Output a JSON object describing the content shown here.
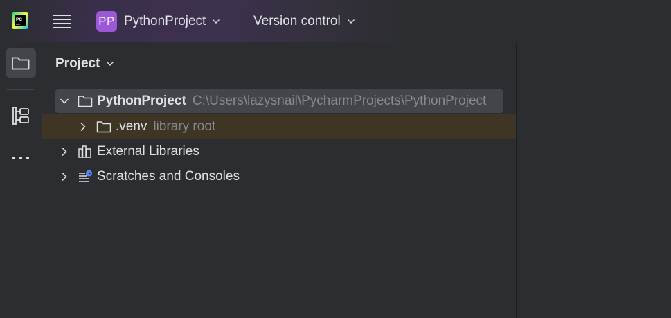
{
  "titlebar": {
    "app_logo": "pycharm-logo",
    "menu_icon": "hamburger-icon",
    "project_badge": "PP",
    "project_name": "PythonProject",
    "vcs_label": "Version control",
    "badge_color": "#9b59d8"
  },
  "toolstrip": {
    "items": [
      {
        "icon": "folder-icon",
        "active": true
      },
      {
        "icon": "structure-icon",
        "active": false
      },
      {
        "icon": "more-icon",
        "active": false
      }
    ]
  },
  "panel": {
    "title": "Project",
    "tree": [
      {
        "label": "PythonProject",
        "hint": "C:\\Users\\lazysnail\\PycharmProjects\\PythonProject",
        "expanded": true,
        "icon": "folder-icon"
      },
      {
        "label": ".venv",
        "hint": "library root",
        "expanded": false,
        "icon": "folder-icon"
      },
      {
        "label": "External Libraries",
        "expanded": false,
        "icon": "libraries-icon"
      },
      {
        "label": "Scratches and Consoles",
        "expanded": false,
        "icon": "scratches-icon"
      }
    ]
  },
  "colors": {
    "background": "#1e1f22",
    "panel": "#2b2d30",
    "selection": "#43454a",
    "library_root_highlight": "#3e3525",
    "hint_text": "#868a91"
  }
}
